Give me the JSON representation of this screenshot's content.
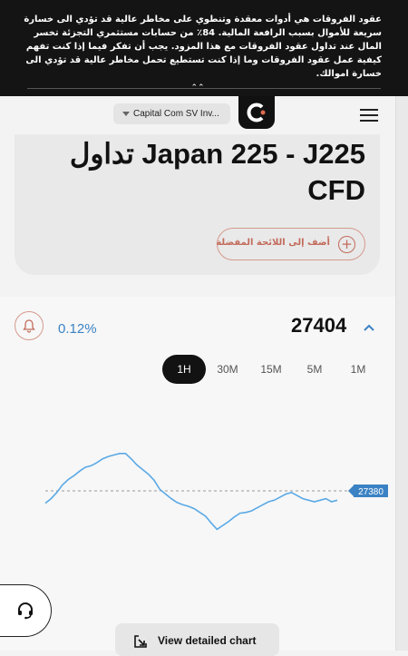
{
  "risk_warning": {
    "text": "عقود الفروقات هي أدوات معقدة وتنطوي على مخاطر عالية قد تؤدي الى خسارة سريعة للأموال بسبب الرافعة المالية. 84٪ من حسابات مستثمري التجزئة تخسر المال عند تداول عقود الفروقات مع هذا المزود. يجب أن تفكر فيما إذا كنت تفهم كيفية عمل عقود الفروقات وما إذا كنت تستطيع تحمل مخاطر عالية قد تؤدي الى خسارة اموالك."
  },
  "header": {
    "entity_selector": "Capital Com SV Inv..."
  },
  "instrument": {
    "title": "تداول Japan 225 - J225 CFD",
    "add_favorite_label": "أضف إلى اللائحة المفضلة"
  },
  "quote": {
    "change_percent": "0.12%",
    "price": "27404",
    "current_price_label": "27380"
  },
  "timeframes": [
    {
      "label": "1H",
      "active": true
    },
    {
      "label": "30M",
      "active": false
    },
    {
      "label": "15M",
      "active": false
    },
    {
      "label": "5M",
      "active": false
    },
    {
      "label": "1M",
      "active": false
    }
  ],
  "detailed_chart_button": "View detailed chart",
  "icons": {
    "collapse": "double-chevron-up-icon",
    "logo": "capital-com-logo",
    "menu": "hamburger-menu-icon",
    "favorite": "plus-circle-icon",
    "alert": "bell-icon",
    "expand": "chevron-up-icon",
    "support": "headset-icon",
    "detailed_chart": "external-link-icon"
  },
  "colors": {
    "line": "#5aa9e6",
    "accent": "#c26b5b",
    "price_tag": "#3b82c4",
    "dark": "#121212"
  },
  "chart_data": {
    "type": "line",
    "reference_value": 27380,
    "ylim": [
      27300,
      27480
    ],
    "series": [
      {
        "values": [
          27362,
          27368,
          27376,
          27386,
          27393,
          27398,
          27404,
          27409,
          27411,
          27415,
          27420,
          27423,
          27425,
          27427,
          27427,
          27420,
          27412,
          27406,
          27400,
          27392,
          27380,
          27374,
          27368,
          27363,
          27360,
          27358,
          27355,
          27350,
          27345,
          27336,
          27328,
          27333,
          27338,
          27344,
          27349,
          27350,
          27352,
          27356,
          27360,
          27364,
          27366,
          27370,
          27374,
          27376,
          27372,
          27368,
          27366,
          27364,
          27366,
          27368,
          27364,
          27366
        ]
      }
    ]
  }
}
